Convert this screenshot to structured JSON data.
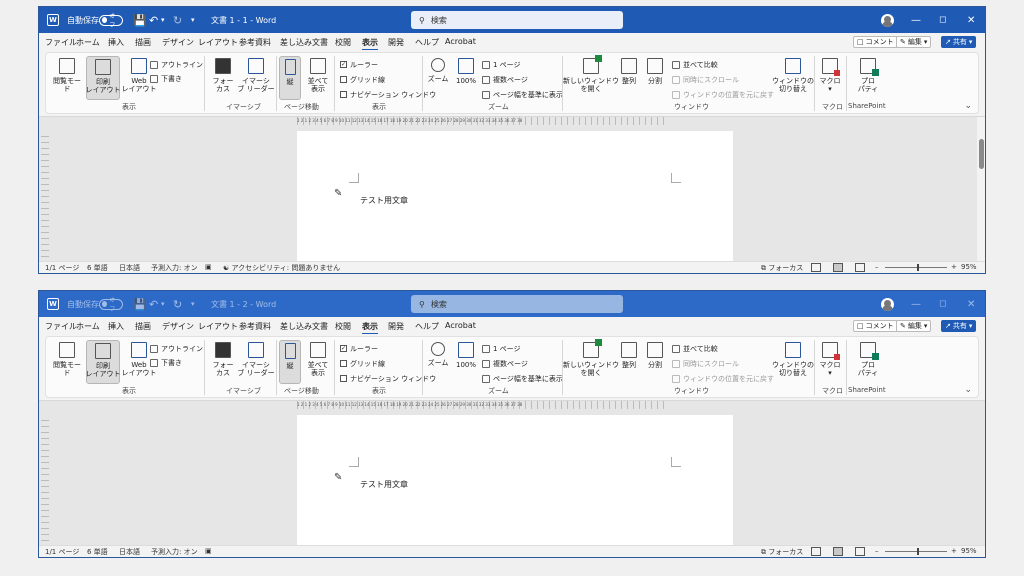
{
  "windows": [
    {
      "title": "文書 1 - 1 - Word",
      "autosave_label": "自動保存",
      "autosave_state": "オフ",
      "search_placeholder": "検索",
      "doc_text": "テスト用文章",
      "status": {
        "page": "1/1 ページ",
        "words": "6 単語",
        "lang": "日本語",
        "ime": "予測入力: オン",
        "accessibility": "アクセシビリティ: 問題ありません",
        "focus": "フォーカス",
        "zoom": "95%"
      }
    },
    {
      "title": "文書 1 - 2 - Word",
      "autosave_label": "自動保存",
      "autosave_state": "オフ",
      "search_placeholder": "検索",
      "doc_text": "テスト用文章",
      "status": {
        "page": "1/1 ページ",
        "words": "6 単語",
        "lang": "日本語",
        "ime": "予測入力: オン",
        "accessibility": "",
        "focus": "フォーカス",
        "zoom": "95%"
      }
    }
  ],
  "menu": [
    "ファイル",
    "ホーム",
    "挿入",
    "描画",
    "デザイン",
    "レイアウト",
    "参考資料",
    "差し込み文書",
    "校閲",
    "表示",
    "開発",
    "ヘルプ",
    "Acrobat"
  ],
  "active_menu": "表示",
  "top_right": {
    "comment": "コメント",
    "edit": "編集",
    "share": "共有"
  },
  "ribbon": {
    "read_mode": "閲覧モード",
    "print_layout": "印刷\nレイアウト",
    "web_layout": "Web\nレイアウト",
    "outline": "アウトライン",
    "draft": "下書き",
    "group_view": "表示",
    "focus": "フォー\nカス",
    "immersive_reader": "イマーシ\nブ リーダー",
    "group_immersive": "イマーシブ",
    "vertical": "縦",
    "side_by_side": "並べて\n表示",
    "group_page_move": "ページ移動",
    "ruler": "ルーラー",
    "gridlines": "グリッド線",
    "navigation_pane": "ナビゲーション ウィンドウ",
    "group_show": "表示",
    "zoom": "ズーム",
    "zoom100": "100%",
    "one_page": "1 ページ",
    "multi_page": "複数ページ",
    "page_width": "ページ幅を基準に表示",
    "group_zoom": "ズーム",
    "new_window": "新しいウィンドウ\nを開く",
    "arrange": "整列",
    "split": "分割",
    "compare": "並べて比較",
    "sync_scroll": "同時にスクロール",
    "reset_position": "ウィンドウの位置を元に戻す",
    "switch_window": "ウィンドウの\n切り替え",
    "group_window": "ウィンドウ",
    "macro": "マクロ",
    "group_macro": "マクロ",
    "properties": "プロ\nパティ",
    "group_sharepoint": "SharePoint"
  },
  "ruler_text": "1 2 1 2 3 4 5 6 7 8 9 10 11 12 13 14 15 16 17 18 19 20 21 22 23 24 25 26 27 28 29 30 31 32 33 34 35 36 37 38",
  "colors": {
    "titlebar": "#1f5bb5",
    "accent": "#2b579a"
  }
}
